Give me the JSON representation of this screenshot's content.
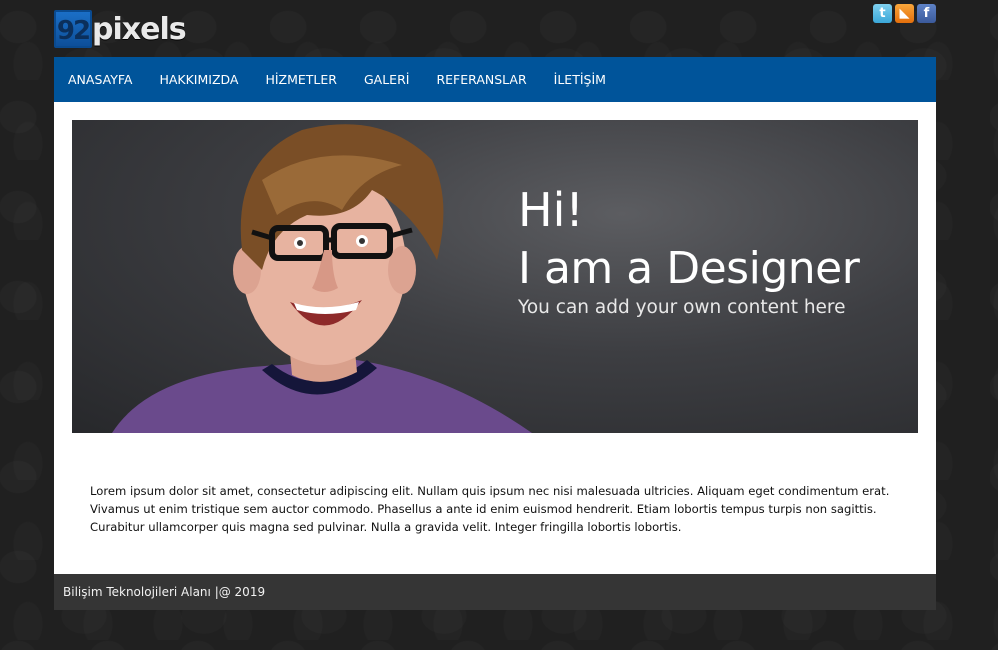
{
  "header": {
    "logo_number": "92",
    "logo_text": "pixels",
    "social": [
      {
        "icon": "twitter-icon",
        "glyph": "t",
        "color": "#3aa7d8"
      },
      {
        "icon": "rss-icon",
        "glyph": "◣",
        "color": "#e36f0c"
      },
      {
        "icon": "facebook-icon",
        "glyph": "f",
        "color": "#3b5a9b"
      }
    ]
  },
  "nav": {
    "items": [
      "ANASAYFA",
      "HAKKIMIZDA",
      "HİZMETLER",
      "GALERİ",
      "REFERANSLAR",
      "İLETİŞİM"
    ],
    "background": "#00549a"
  },
  "banner": {
    "greeting": "Hi!",
    "headline": "I am a Designer",
    "subline": "You can add your own content here"
  },
  "main": {
    "paragraph": "Lorem ipsum dolor sit amet, consectetur adipiscing elit. Nullam quis ipsum nec nisi malesuada ultricies. Aliquam eget condimentum erat. Vivamus ut enim tristique sem auctor commodo. Phasellus a ante id enim euismod hendrerit. Etiam lobortis tempus turpis non sagittis. Curabitur ullamcorper quis magna sed pulvinar. Nulla a gravida velit. Integer fringilla lobortis lobortis."
  },
  "footer": {
    "text": "Bilişim Teknolojileri Alanı |@ 2019"
  }
}
